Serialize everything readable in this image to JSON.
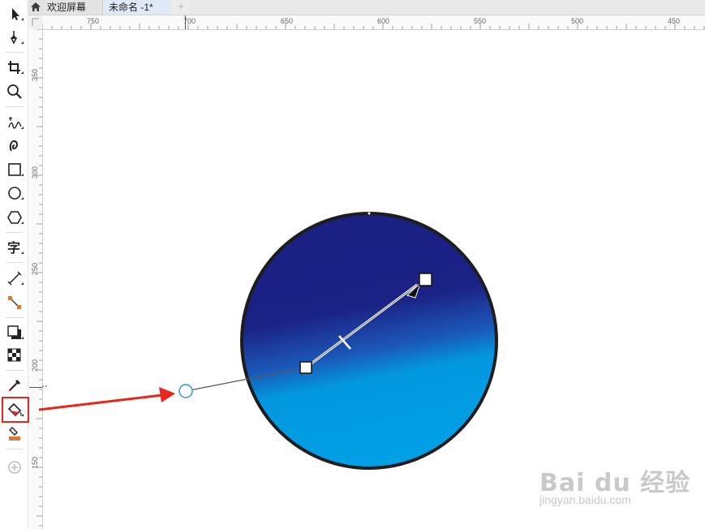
{
  "tabs": [
    {
      "label": "欢迎屏幕",
      "icon": "home-icon"
    },
    {
      "label": "未命名 -1*"
    },
    {
      "label": "+"
    }
  ],
  "ruler": {
    "horizontal_labels": [
      "750",
      "700",
      "650",
      "600",
      "550",
      "500",
      "450"
    ],
    "vertical_labels": [
      "350",
      "300",
      "250",
      "200",
      "150"
    ]
  },
  "toolbox": {
    "tools": [
      "pick-tool-icon",
      "shape-tool-icon",
      "crop-tool-icon",
      "zoom-tool-icon",
      "freehand-tool-icon",
      "artistic-media-tool-icon",
      "rectangle-tool-icon",
      "ellipse-tool-icon",
      "polygon-tool-icon",
      "text-tool-icon",
      "parallel-dimension-tool-icon",
      "connector-tool-icon",
      "drop-shadow-tool-icon",
      "transparency-tool-icon",
      "eyedropper-tool-icon",
      "interactive-fill-tool-icon",
      "smart-fill-tool-icon",
      "add-tool-icon"
    ],
    "text_tool_glyph": "字",
    "selected_tool": "interactive-fill-tool-icon"
  },
  "drawing": {
    "circle_colors": {
      "top": "#1b1f82",
      "bottom": "#00a0e6",
      "outline": "#1d1d1d"
    },
    "gradient_handle_color": "#3399cc",
    "annotation_arrow_color": "#e8271c"
  },
  "watermark": {
    "logo": "Bai du 经验",
    "url": "jingyan.baidu.com"
  }
}
